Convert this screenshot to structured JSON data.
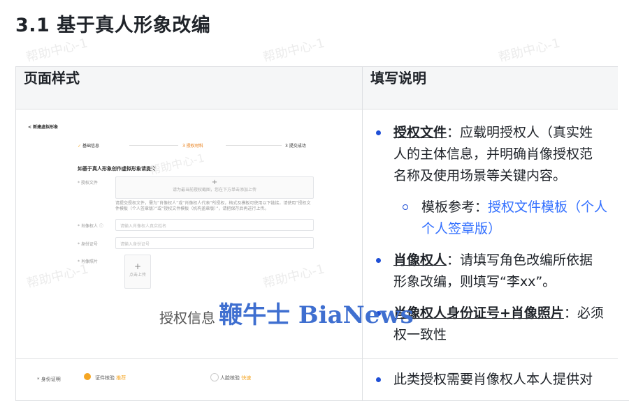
{
  "heading": "3.1 基于真人形象改编",
  "watermark": "帮助中心-1",
  "table": {
    "col1_header": "页面样式",
    "col2_header": "填写说明"
  },
  "form": {
    "back_title": "< 新建虚拟形象",
    "steps": [
      "基础信息",
      "3 授权材料",
      "3 提交成功"
    ],
    "section_title": "如基于真人形象创作虚拟形象请提交",
    "auth_file_label": "* 授权文件",
    "upload_plus": "+",
    "upload_hint": "请为最当前授权截图，您在下方单击添加上传",
    "auth_note": "请提交授权文件，需为“肖像权人”或“肖像权人代表”所授权，格式及模板可使用以下链接，请使用“授权文件模板（个人签章版）”或“授权文件模板（机构盖章版）”，请把保存后再进行上传。",
    "portrait_label": "* 肖像权人 ⓘ",
    "portrait_placeholder": "请输入肖像权人真实姓名",
    "id_label": "* 身份证号",
    "id_placeholder": "请输入身份证号",
    "photo_label": "* 肖像照片",
    "photo_plus": "+",
    "photo_upload": "点击上传",
    "overlay_text": "授权信息",
    "bianews": "鞭牛士 BiaNews",
    "row2_label": "* 身份证明",
    "row2_opt1": "证件核验",
    "row2_opt1_tag": "推荐",
    "row2_opt2": "人脸核验",
    "row2_opt2_tag": "快速"
  },
  "notes": {
    "b1_title": "授权文件",
    "b1_text1": "：应载明授权人（真实姓",
    "b1_text2": "人的主体信息，并明确肖像授权范",
    "b1_text3": "名称及使用场景等关键内容。",
    "sub_label": "模板参考：",
    "sub_link1": "授权文件模板（个人",
    "sub_link2": "个人签章版）",
    "b2_title": "肖像权人",
    "b2_text1": "：请填写角色改编所依据",
    "b2_text2": "形象改编，则填写“李xx”。",
    "b3_title": "肖像权人身份证号+肖像照片",
    "b3_text1": "：必须",
    "b3_text2": "权一致性",
    "b4_text": "此类授权需要肖像权人本人提供对"
  }
}
